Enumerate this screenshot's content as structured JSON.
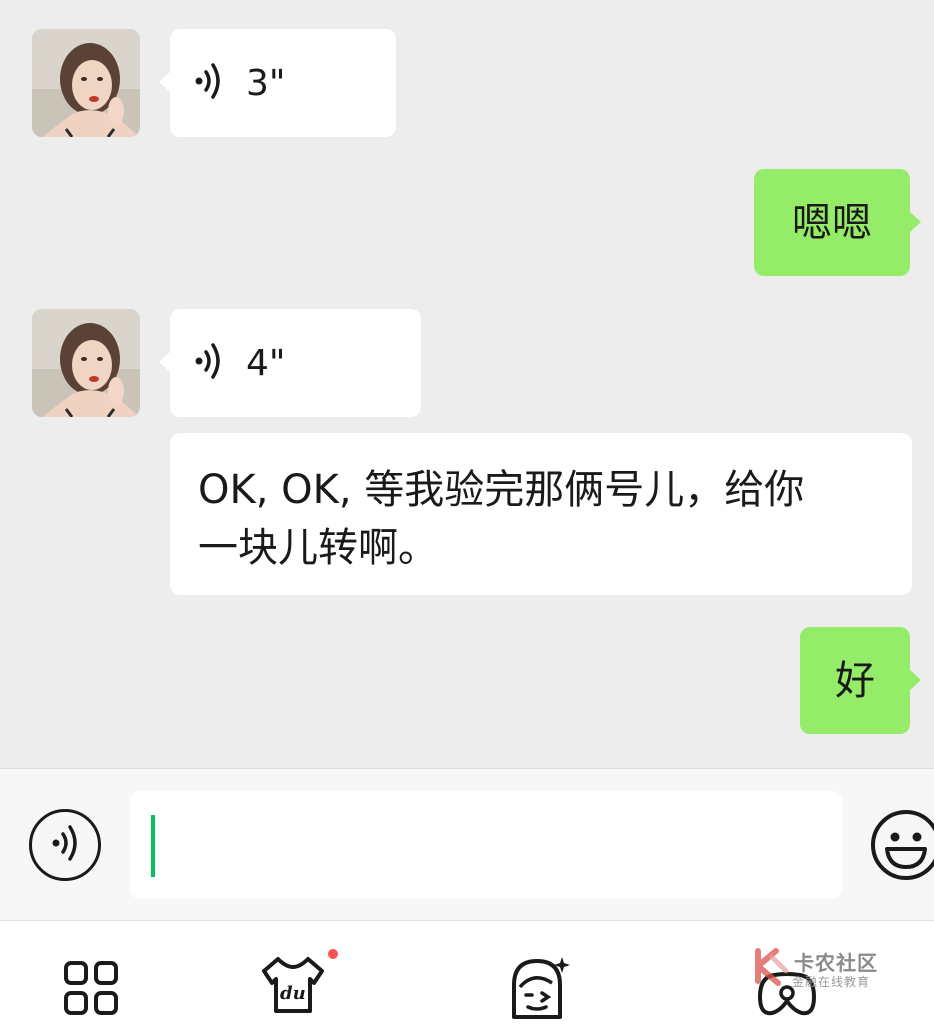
{
  "messages": [
    {
      "type": "voice",
      "from": "contact",
      "duration": "3\""
    },
    {
      "type": "text",
      "from": "me",
      "text": "嗯嗯"
    },
    {
      "type": "voice",
      "from": "contact",
      "duration": "4\""
    },
    {
      "type": "text",
      "from": "contact",
      "text": "OK, OK, 等我验完那俩号儿，给你\n一块儿转啊。"
    },
    {
      "type": "text",
      "from": "me",
      "text": "好"
    }
  ],
  "input": {
    "value": "",
    "voice_toggle_icon": "voice-icon",
    "emoji_icon": "smiley-face-icon"
  },
  "bottom_bar": {
    "items": [
      {
        "icon": "apps-grid-icon"
      },
      {
        "icon": "du-tshirt-icon",
        "badge": true
      },
      {
        "icon": "face-sparkle-icon"
      },
      {
        "icon": "game-controller-icon"
      }
    ]
  },
  "watermark": {
    "title": "卡农社区",
    "subtitle": "金融在线教育"
  },
  "colors": {
    "background": "#ededed",
    "incoming_bubble": "#ffffff",
    "outgoing_bubble": "#95ec69",
    "caret": "#07c160",
    "badge": "#fa5151"
  }
}
